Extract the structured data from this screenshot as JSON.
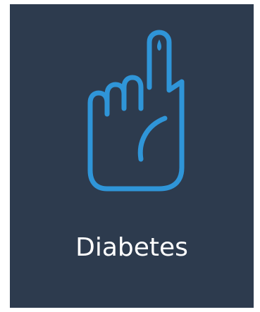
{
  "tile": {
    "label": "Diabetes",
    "icon": "finger-blood-drop-icon",
    "background_color": "#2d3b4e",
    "icon_color": "#2f95d8",
    "label_color": "#ffffff"
  }
}
